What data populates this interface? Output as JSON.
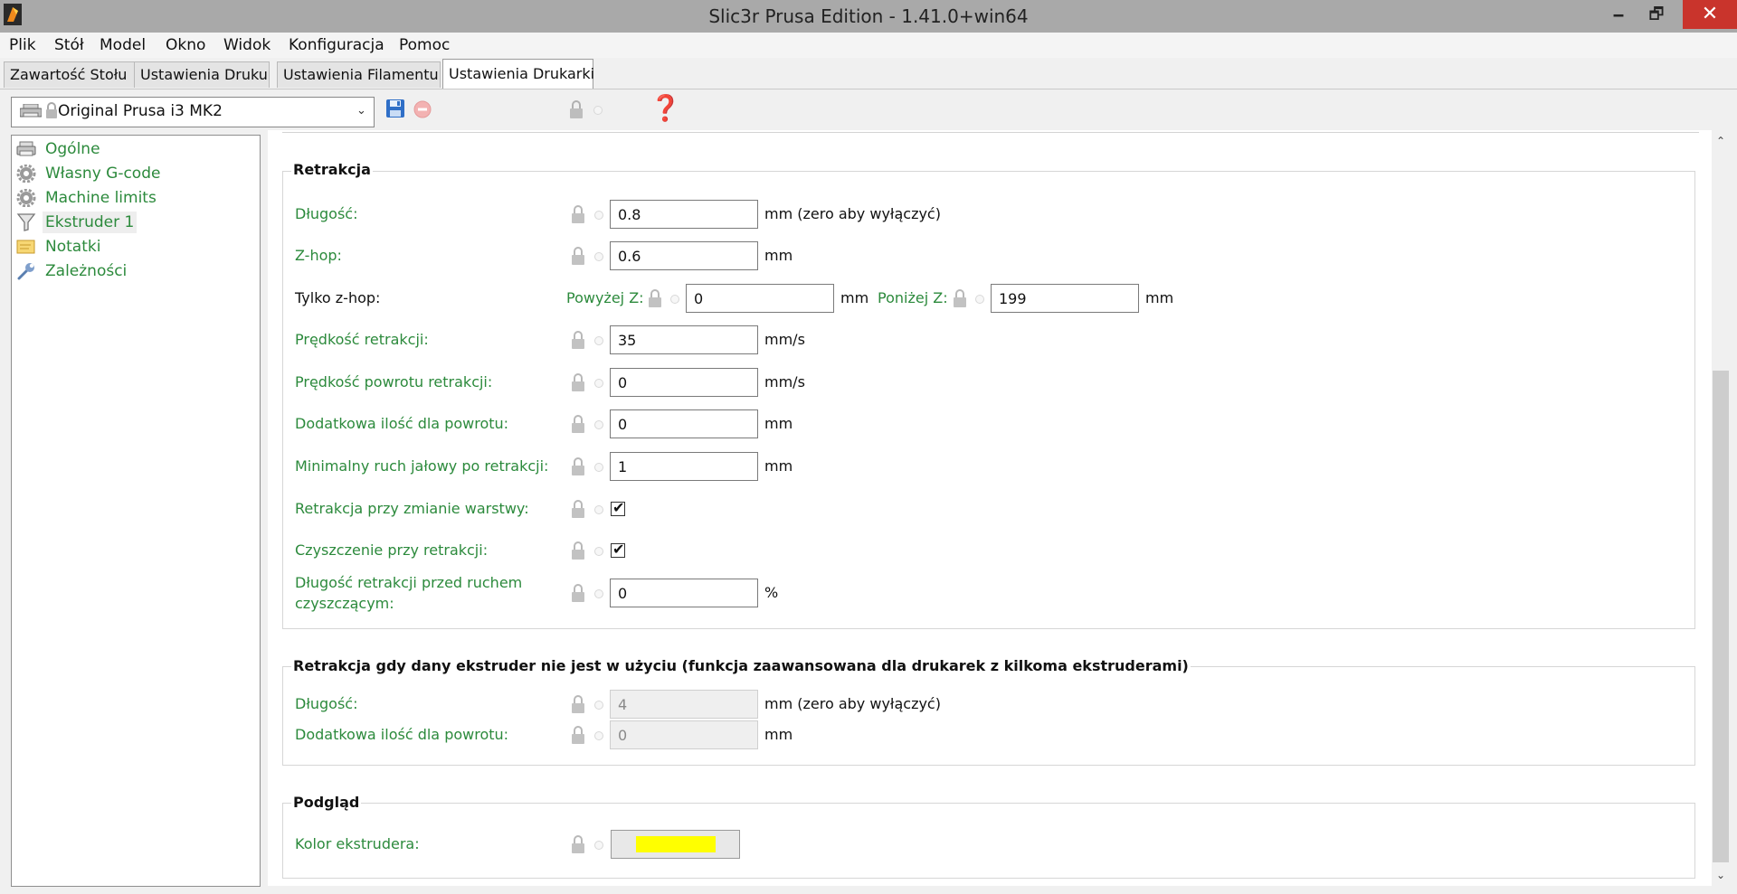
{
  "window": {
    "title": "Slic3r Prusa Edition - 1.41.0+win64",
    "minimize_glyph": "🗕",
    "maximize_glyph": "🗗",
    "close_glyph": "✕"
  },
  "menu": [
    "Plik",
    "Stół",
    "Model",
    "Okno",
    "Widok",
    "Konfiguracja",
    "Pomoc"
  ],
  "tabs": [
    {
      "label": "Zawartość Stołu",
      "active": false
    },
    {
      "label": "Ustawienia Druku",
      "active": false
    },
    {
      "label": "Ustawienia Filamentu",
      "active": false
    },
    {
      "label": "Ustawienia Drukarki",
      "active": true
    }
  ],
  "preset": {
    "selected": "Original Prusa i3 MK2",
    "chevron": "⌄",
    "help_glyph": "❓"
  },
  "tree": [
    {
      "label": "Ogólne",
      "icon": "printer-icon",
      "selected": false
    },
    {
      "label": "Własny G-code",
      "icon": "gear-icon",
      "selected": false
    },
    {
      "label": "Machine limits",
      "icon": "gear-icon",
      "selected": false
    },
    {
      "label": "Ekstruder 1",
      "icon": "funnel-icon",
      "selected": true
    },
    {
      "label": "Notatki",
      "icon": "note-icon",
      "selected": false
    },
    {
      "label": "Zależności",
      "icon": "wrench-icon",
      "selected": false
    }
  ],
  "retraction": {
    "title": "Retrakcja",
    "length": {
      "label": "Długość:",
      "value": "0.8",
      "unit": "mm (zero aby wyłączyć)"
    },
    "zhop": {
      "label": "Z-hop:",
      "value": "0.6",
      "unit": "mm"
    },
    "only_zhop": {
      "label": "Tylko z-hop:",
      "above_label": "Powyżej Z:",
      "above_value": "0",
      "above_unit": "mm",
      "below_label": "Poniżej Z:",
      "below_value": "199",
      "below_unit": "mm"
    },
    "speed": {
      "label": "Prędkość retrakcji:",
      "value": "35",
      "unit": "mm/s"
    },
    "deretract_speed": {
      "label": "Prędkość powrotu retrakcji:",
      "value": "0",
      "unit": "mm/s"
    },
    "extra_restart": {
      "label": "Dodatkowa ilość dla powrotu:",
      "value": "0",
      "unit": "mm"
    },
    "min_travel": {
      "label": "Minimalny ruch jałowy po retrakcji:",
      "value": "1",
      "unit": "mm"
    },
    "layer_change": {
      "label": "Retrakcja przy zmianie warstwy:",
      "checked": true
    },
    "wipe": {
      "label": "Czyszczenie przy retrakcji:",
      "checked": true
    },
    "before_wipe": {
      "label_line1": "Długość retrakcji przed ruchem",
      "label_line2": "czyszczącym:",
      "value": "0",
      "unit": "%"
    }
  },
  "toolchange": {
    "title": "Retrakcja gdy dany ekstruder nie jest w użyciu (funkcja zaawansowana dla drukarek z kilkoma ekstruderami)",
    "length": {
      "label": "Długość:",
      "value": "4",
      "unit": "mm (zero aby wyłączyć)"
    },
    "extra": {
      "label": "Dodatkowa ilość dla powrotu:",
      "value": "0",
      "unit": "mm"
    }
  },
  "preview": {
    "title": "Podgląd",
    "color_label": "Kolor ekstrudera:",
    "color_value": "#ffff00"
  },
  "check_glyph": "✔",
  "scroll": {
    "up": "⌃",
    "down": "⌄"
  }
}
